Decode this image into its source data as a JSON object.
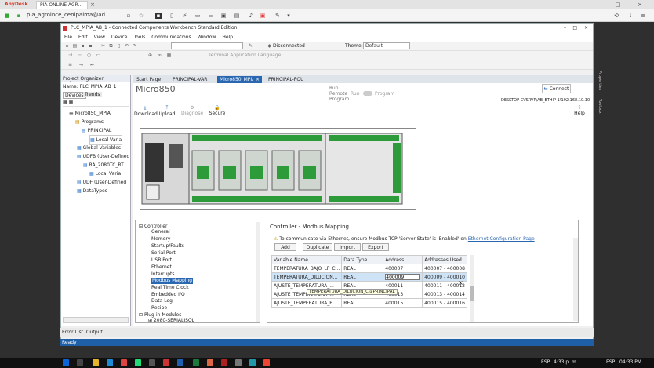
{
  "anydesk": {
    "tab1": "AnyDesk",
    "tab2": "PIA ONLINE AGR...",
    "address": "pia_agroince_cenipalma@ad"
  },
  "app": {
    "title": "PLC_MPIA_AB_1 - Connected Components Workbench Standard Edition",
    "menu": [
      "File",
      "Edit",
      "View",
      "Device",
      "Tools",
      "Communications",
      "Window",
      "Help"
    ],
    "connection": "Disconnected",
    "theme_label": "Theme:",
    "theme": "Default",
    "terminal": "Terminal Application Language:"
  },
  "organizer": {
    "title": "Project Organizer",
    "name_label": "Name:",
    "name": "PLC_MPIA_AB_1",
    "tabs": [
      "Devices",
      "Trends"
    ],
    "tree": [
      "Micro850_MPIA",
      "Programs",
      "PRINCIPAL",
      "Local Varia",
      "Global Variables",
      "UDFB (User-Defined",
      "RA_2080TC_RT",
      "Local Varia",
      "UDF (User-Defined",
      "DataTypes"
    ]
  },
  "doc_tabs": [
    "Start Page",
    "PRINCIPAL-VAR",
    "Micro850_MPIA",
    "PRINCIPAL-POU"
  ],
  "device": {
    "title": "Micro850",
    "run": "Run",
    "remote": "Remote",
    "run2": "Run",
    "program_toggle": "Program",
    "program": "Program",
    "connect": "Connect",
    "path": "DESKTOP-CVSRVP\\AB_ETHIP-1\\192.168.10.10",
    "download": "Download",
    "upload": "Upload",
    "diagnose": "Diagnose",
    "secure": "Secure",
    "help": "Help"
  },
  "controller_tree": {
    "root": "Controller",
    "items": [
      "General",
      "Memory",
      "Startup/Faults",
      "Serial Port",
      "USB Port",
      "Ethernet",
      "Interrupts",
      "Modbus Mapping",
      "Real Time Clock",
      "Embedded I/O",
      "Data Log",
      "Recipe"
    ],
    "plugins": "Plug-in Modules",
    "plugin1": "2080-SERIALISOL"
  },
  "modbus": {
    "title": "Controller - Modbus Mapping",
    "note": "To communicate via Ethernet, ensure Modbus TCP 'Server State' is 'Enabled' on",
    "link": "Ethernet Configuration Page",
    "buttons": [
      "Add",
      "Duplicate",
      "Import",
      "Export"
    ],
    "columns": [
      "Variable Name",
      "Data Type",
      "Address",
      "Addresses Used"
    ],
    "rows": [
      [
        "TEMPERATURA_BAJO_LP_C...",
        "REAL",
        "400007",
        "400007 - 400008"
      ],
      [
        "TEMPERATURA_DILUCION...",
        "REAL",
        "400009",
        "400009 - 400010"
      ],
      [
        "AJUSTE_TEMPERATURA_...",
        "REAL",
        "400011",
        "400011 - 400012"
      ],
      [
        "AJUSTE_TEMPERATURA_...",
        "REAL",
        "400013",
        "400013 - 400014"
      ],
      [
        "AJUSTE_TEMPERATURA_B...",
        "REAL",
        "400015",
        "400015 - 400016"
      ]
    ],
    "tooltip": "TEMPERATURA_DILUCION_C@PRINCIPAL"
  },
  "bottom": {
    "error_list": "Error List",
    "output": "Output",
    "status": "Ready"
  },
  "taskbar": {
    "lang": "ESP",
    "time": "4:33 p. m.",
    "time2": "04:33 PM",
    "lang2": "ESP"
  }
}
